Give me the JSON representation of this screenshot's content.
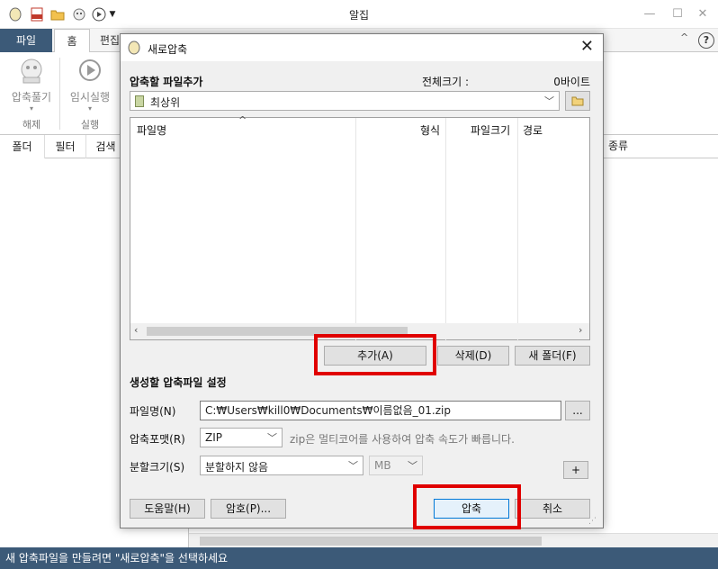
{
  "app": {
    "title": "알집",
    "ribbon_tabs": [
      "파일",
      "홈",
      "편집"
    ],
    "ribbon_items": [
      {
        "label": "압축풀기",
        "sub": "▾"
      },
      {
        "label": "임시실행",
        "sub": "▾"
      }
    ],
    "ribbon_groups": [
      "해제",
      "실행"
    ],
    "pane_tabs": [
      "폴더",
      "필터",
      "검색"
    ],
    "list_col_kind": "종류",
    "status": "새 압축파일을 만들려면 \"새로압축\"을 선택하세요",
    "help_glyph": "?",
    "collapse_glyph": "^"
  },
  "dialog": {
    "title": "새로압축",
    "add_files_title": "압축할 파일추가",
    "total_size_label": "전체크기 :",
    "total_size_value": "0바이트",
    "location": "최상위",
    "columns": [
      "파일명",
      "형식",
      "파일크기",
      "경로"
    ],
    "btn_add": "추가(A)",
    "btn_delete": "삭제(D)",
    "btn_new_folder": "새 폴더(F)",
    "settings_title": "생성할 압축파일 설정",
    "filename_label": "파일명(N)",
    "filename_value": "C:₩Users₩kill0₩Documents₩이름없음_01.zip",
    "browse_label": "...",
    "format_label": "압축포맷(R)",
    "format_value": "ZIP",
    "format_hint": "zip은 멀티코어를 사용하여 압축 속도가 빠릅니다.",
    "split_label": "분할크기(S)",
    "split_value": "분할하지 않음",
    "unit_value": "MB",
    "plus_label": "+",
    "btn_help": "도움말(H)",
    "btn_password": "암호(P)...",
    "btn_compress": "압축",
    "btn_cancel": "취소"
  },
  "colors": {
    "accent": "#3c5a78",
    "highlight": "#e00000",
    "primary_border": "#0078d7"
  }
}
